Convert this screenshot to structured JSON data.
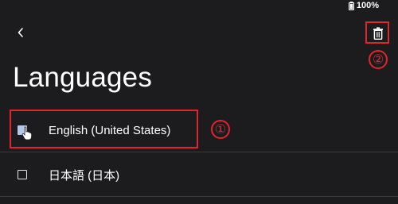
{
  "status_bar": {
    "battery_text": "100%",
    "icon": "battery-icon"
  },
  "toolbar": {
    "back_icon": "chevron-left-icon",
    "delete_icon": "trash-icon"
  },
  "page": {
    "title": "Languages"
  },
  "languages": [
    {
      "label": "English (United States)",
      "checked": true
    },
    {
      "label": "日本語 (日本)",
      "checked": false
    }
  ],
  "annotations": {
    "marker_1": "①",
    "marker_2": "②",
    "highlight_color": "#e0262b"
  },
  "colors": {
    "background": "#1c1c1e",
    "checkbox_checked": "#b5c7ea",
    "text": "#ffffff"
  }
}
